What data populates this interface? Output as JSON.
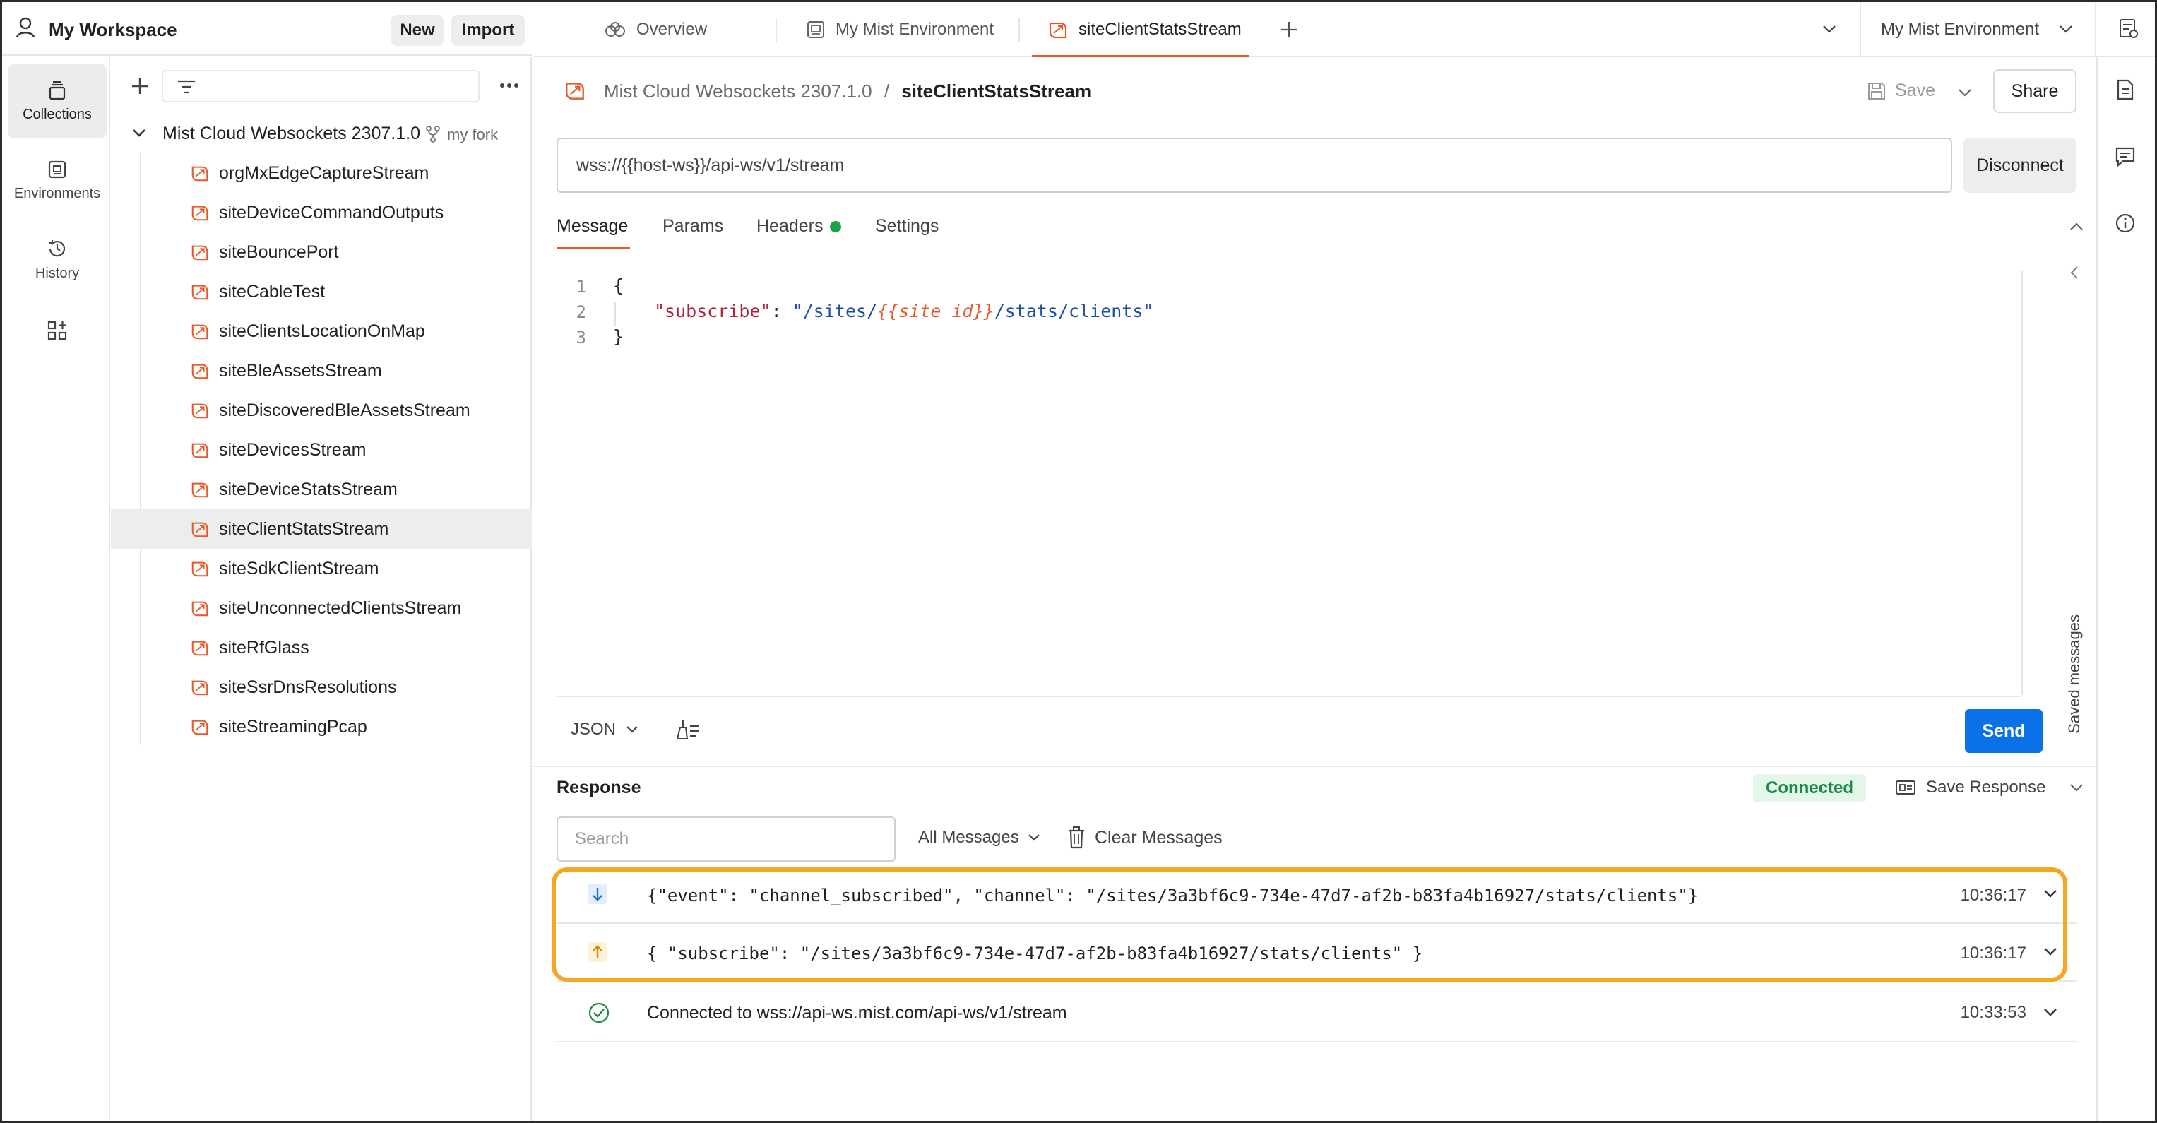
{
  "workspace": {
    "title": "My Workspace",
    "new_label": "New",
    "import_label": "Import"
  },
  "rail": {
    "collections": "Collections",
    "environments": "Environments",
    "history": "History"
  },
  "sidebar": {
    "filter_placeholder": "",
    "collection_name": "Mist Cloud Websockets 2307.1.0",
    "fork_label": "my fork",
    "items": [
      {
        "label": "orgMxEdgeCaptureStream"
      },
      {
        "label": "siteDeviceCommandOutputs"
      },
      {
        "label": "siteBouncePort"
      },
      {
        "label": "siteCableTest"
      },
      {
        "label": "siteClientsLocationOnMap"
      },
      {
        "label": "siteBleAssetsStream"
      },
      {
        "label": "siteDiscoveredBleAssetsStream"
      },
      {
        "label": "siteDevicesStream"
      },
      {
        "label": "siteDeviceStatsStream"
      },
      {
        "label": "siteClientStatsStream"
      },
      {
        "label": "siteSdkClientStream"
      },
      {
        "label": "siteUnconnectedClientsStream"
      },
      {
        "label": "siteRfGlass"
      },
      {
        "label": "siteSsrDnsResolutions"
      },
      {
        "label": "siteStreamingPcap"
      }
    ],
    "active_item": "siteClientStatsStream"
  },
  "tabs": [
    {
      "label": "Overview"
    },
    {
      "label": "My Mist Environment"
    },
    {
      "label": "siteClientStatsStream"
    }
  ],
  "environment_select": "My Mist Environment",
  "request": {
    "breadcrumb_parent": "Mist Cloud Websockets 2307.1.0",
    "breadcrumb_sep": "/",
    "breadcrumb_current": "siteClientStatsStream",
    "save_label": "Save",
    "share_label": "Share",
    "url": "wss://{{host-ws}}/api-ws/v1/stream",
    "disconnect_label": "Disconnect",
    "tabs": {
      "message": "Message",
      "params": "Params",
      "headers": "Headers",
      "settings": "Settings"
    },
    "code": {
      "line_numbers": [
        "1",
        "2",
        "3"
      ],
      "open_brace": "{",
      "key": "\"subscribe\"",
      "colon": ": ",
      "value_prefix": "\"/sites/",
      "value_var": "{{site_id}}",
      "value_suffix": "/stats/clients\"",
      "close_brace": "}"
    },
    "format": "JSON",
    "send_label": "Send",
    "saved_messages": "Saved messages"
  },
  "response": {
    "title": "Response",
    "status": "Connected",
    "save_response": "Save Response",
    "search_placeholder": "Search",
    "filter": "All Messages",
    "clear": "Clear Messages",
    "messages": [
      {
        "direction": "received",
        "text": "{\"event\": \"channel_subscribed\", \"channel\": \"/sites/3a3bf6c9-734e-47d7-af2b-b83fa4b16927/stats/clients\"}",
        "time": "10:36:17"
      },
      {
        "direction": "sent",
        "text": "{ \"subscribe\": \"/sites/3a3bf6c9-734e-47d7-af2b-b83fa4b16927/stats/clients\" }",
        "time": "10:36:17"
      },
      {
        "direction": "connected",
        "text": "Connected to wss://api-ws.mist.com/api-ws/v1/stream",
        "time": "10:33:53"
      }
    ]
  },
  "colors": {
    "accent": "#e55a2b",
    "send": "#0a72e6",
    "connected_text": "#1a8a45",
    "highlight": "#f5a623",
    "received_icon": "#1f6fd1",
    "sent_icon": "#d68a00",
    "success": "#1a8a45"
  }
}
